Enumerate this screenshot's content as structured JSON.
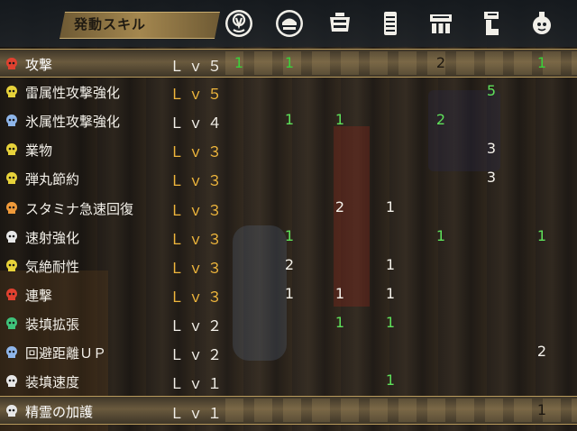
{
  "header": {
    "title": "発動スキル",
    "columns": [
      {
        "icon": "weapon-slot-icon"
      },
      {
        "icon": "helm-icon"
      },
      {
        "icon": "chest-icon"
      },
      {
        "icon": "arms-icon"
      },
      {
        "icon": "waist-icon"
      },
      {
        "icon": "legs-icon"
      },
      {
        "icon": "charm-icon"
      }
    ]
  },
  "colors": {
    "max_level": "#f0b73c",
    "normal_level": "#f4f1ea",
    "contribution_green": "#5fe05a",
    "contribution_white": "#f4f1ea"
  },
  "skills": [
    {
      "name": "攻撃",
      "level": "Ｌｖ５",
      "max": false,
      "icon_color": "#e0412f",
      "highlight": true,
      "cells": [
        {
          "v": "1",
          "c": "green"
        },
        {
          "v": "1",
          "c": "green"
        },
        {
          "v": "",
          "c": ""
        },
        {
          "v": "",
          "c": ""
        },
        {
          "v": "2",
          "c": "white"
        },
        {
          "v": "",
          "c": ""
        },
        {
          "v": "1",
          "c": "green"
        }
      ]
    },
    {
      "name": "雷属性攻撃強化",
      "level": "Ｌｖ５",
      "max": true,
      "icon_color": "#e7d23a",
      "highlight": false,
      "cells": [
        {
          "v": "",
          "c": ""
        },
        {
          "v": "",
          "c": ""
        },
        {
          "v": "",
          "c": ""
        },
        {
          "v": "",
          "c": ""
        },
        {
          "v": "",
          "c": ""
        },
        {
          "v": "5",
          "c": "green"
        },
        {
          "v": "",
          "c": ""
        }
      ]
    },
    {
      "name": "氷属性攻撃強化",
      "level": "Ｌｖ４",
      "max": false,
      "icon_color": "#8fb6ea",
      "highlight": false,
      "cells": [
        {
          "v": "",
          "c": ""
        },
        {
          "v": "1",
          "c": "green"
        },
        {
          "v": "1",
          "c": "green"
        },
        {
          "v": "",
          "c": ""
        },
        {
          "v": "2",
          "c": "green"
        },
        {
          "v": "",
          "c": ""
        },
        {
          "v": "",
          "c": ""
        }
      ]
    },
    {
      "name": "業物",
      "level": "Ｌｖ３",
      "max": true,
      "icon_color": "#e7d23a",
      "highlight": false,
      "cells": [
        {
          "v": "",
          "c": ""
        },
        {
          "v": "",
          "c": ""
        },
        {
          "v": "",
          "c": ""
        },
        {
          "v": "",
          "c": ""
        },
        {
          "v": "",
          "c": ""
        },
        {
          "v": "3",
          "c": "white"
        },
        {
          "v": "",
          "c": ""
        }
      ]
    },
    {
      "name": "弾丸節約",
      "level": "Ｌｖ３",
      "max": true,
      "icon_color": "#e7d23a",
      "highlight": false,
      "cells": [
        {
          "v": "",
          "c": ""
        },
        {
          "v": "",
          "c": ""
        },
        {
          "v": "",
          "c": ""
        },
        {
          "v": "",
          "c": ""
        },
        {
          "v": "",
          "c": ""
        },
        {
          "v": "3",
          "c": "white"
        },
        {
          "v": "",
          "c": ""
        }
      ]
    },
    {
      "name": "スタミナ急速回復",
      "level": "Ｌｖ３",
      "max": true,
      "icon_color": "#f09a3a",
      "highlight": false,
      "cells": [
        {
          "v": "",
          "c": ""
        },
        {
          "v": "",
          "c": ""
        },
        {
          "v": "2",
          "c": "white"
        },
        {
          "v": "1",
          "c": "white"
        },
        {
          "v": "",
          "c": ""
        },
        {
          "v": "",
          "c": ""
        },
        {
          "v": "",
          "c": ""
        }
      ]
    },
    {
      "name": "速射強化",
      "level": "Ｌｖ３",
      "max": true,
      "icon_color": "#e8e8e8",
      "highlight": false,
      "cells": [
        {
          "v": "",
          "c": ""
        },
        {
          "v": "1",
          "c": "green"
        },
        {
          "v": "",
          "c": ""
        },
        {
          "v": "",
          "c": ""
        },
        {
          "v": "1",
          "c": "green"
        },
        {
          "v": "",
          "c": ""
        },
        {
          "v": "1",
          "c": "green"
        }
      ]
    },
    {
      "name": "気絶耐性",
      "level": "Ｌｖ３",
      "max": true,
      "icon_color": "#e7d23a",
      "highlight": false,
      "cells": [
        {
          "v": "",
          "c": ""
        },
        {
          "v": "2",
          "c": "white"
        },
        {
          "v": "",
          "c": ""
        },
        {
          "v": "1",
          "c": "white"
        },
        {
          "v": "",
          "c": ""
        },
        {
          "v": "",
          "c": ""
        },
        {
          "v": "",
          "c": ""
        }
      ]
    },
    {
      "name": "連撃",
      "level": "Ｌｖ３",
      "max": true,
      "icon_color": "#e0412f",
      "highlight": false,
      "cells": [
        {
          "v": "",
          "c": ""
        },
        {
          "v": "1",
          "c": "white"
        },
        {
          "v": "1",
          "c": "white"
        },
        {
          "v": "1",
          "c": "white"
        },
        {
          "v": "",
          "c": ""
        },
        {
          "v": "",
          "c": ""
        },
        {
          "v": "",
          "c": ""
        }
      ]
    },
    {
      "name": "装填拡張",
      "level": "Ｌｖ２",
      "max": false,
      "icon_color": "#3fc27a",
      "highlight": false,
      "cells": [
        {
          "v": "",
          "c": ""
        },
        {
          "v": "",
          "c": ""
        },
        {
          "v": "1",
          "c": "green"
        },
        {
          "v": "1",
          "c": "green"
        },
        {
          "v": "",
          "c": ""
        },
        {
          "v": "",
          "c": ""
        },
        {
          "v": "",
          "c": ""
        }
      ]
    },
    {
      "name": "回避距離ＵＰ",
      "level": "Ｌｖ２",
      "max": false,
      "icon_color": "#8fb6ea",
      "highlight": false,
      "cells": [
        {
          "v": "",
          "c": ""
        },
        {
          "v": "",
          "c": ""
        },
        {
          "v": "",
          "c": ""
        },
        {
          "v": "",
          "c": ""
        },
        {
          "v": "",
          "c": ""
        },
        {
          "v": "",
          "c": ""
        },
        {
          "v": "2",
          "c": "white"
        }
      ]
    },
    {
      "name": "装填速度",
      "level": "Ｌｖ１",
      "max": false,
      "icon_color": "#e8e8e8",
      "highlight": false,
      "cells": [
        {
          "v": "",
          "c": ""
        },
        {
          "v": "",
          "c": ""
        },
        {
          "v": "",
          "c": ""
        },
        {
          "v": "1",
          "c": "green"
        },
        {
          "v": "",
          "c": ""
        },
        {
          "v": "",
          "c": ""
        },
        {
          "v": "",
          "c": ""
        }
      ]
    },
    {
      "name": "精霊の加護",
      "level": "Ｌｖ１",
      "max": false,
      "icon_color": "#e8e8e8",
      "highlight": true,
      "cells": [
        {
          "v": "",
          "c": ""
        },
        {
          "v": "",
          "c": ""
        },
        {
          "v": "",
          "c": ""
        },
        {
          "v": "",
          "c": ""
        },
        {
          "v": "",
          "c": ""
        },
        {
          "v": "",
          "c": ""
        },
        {
          "v": "1",
          "c": "white"
        }
      ]
    }
  ]
}
